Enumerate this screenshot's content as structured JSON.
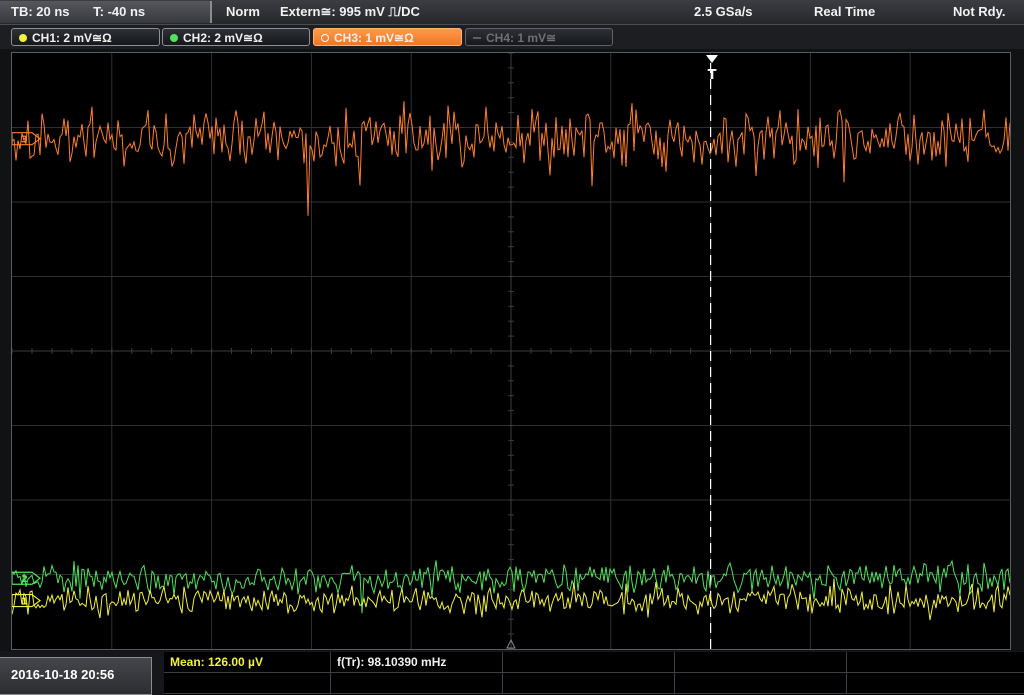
{
  "topbar": {
    "timebase": "TB: 20 ns",
    "trigger_offset": "T: -40 ns",
    "trigger_mode": "Norm",
    "trigger_source": "Extern≅: 995 mV ⎍/DC",
    "sample_rate": "2.5 GSa/s",
    "acq_mode": "Real Time",
    "run_state": "Not Rdy."
  },
  "channels": [
    {
      "label": "CH1: 2 mV≅Ω",
      "color": "#f2f23a",
      "active": true
    },
    {
      "label": "CH2: 2 mV≅Ω",
      "color": "#4fe25a",
      "active": true
    },
    {
      "label": "CH3: 1 mV≅Ω",
      "color": "#ff7f2a",
      "active": true,
      "selected": true
    },
    {
      "label": "CH4: 1 mV≅",
      "color": "#5c5e64",
      "active": false
    }
  ],
  "screen": {
    "trigger_marker": "T",
    "grid_divisions": {
      "horizontal": 10,
      "vertical": 8
    },
    "trace_colors": {
      "ch1": "#f2f23a",
      "ch2": "#4fe25a",
      "ch3": "#ff7f2a"
    },
    "trace_levels_div": {
      "ch1": 0.65,
      "ch2": 0.95,
      "ch3": 6.85
    },
    "trigger_time_div": 2.0
  },
  "measurements": {
    "mean": "Mean: 126.00 µV",
    "frequency": "f(Tr): 98.10390 mHz"
  },
  "datetime": "2016-10-18 20:56"
}
